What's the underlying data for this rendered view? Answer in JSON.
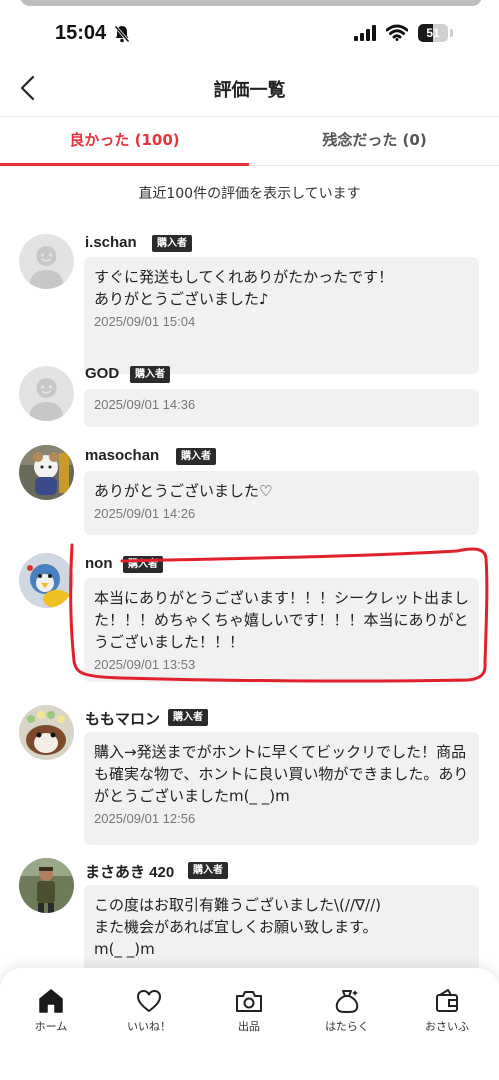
{
  "status_bar": {
    "time": "15:04",
    "battery": "51",
    "battery_level": 0.51
  },
  "header": {
    "title": "評価一覧"
  },
  "tabs": [
    {
      "label": "良かった (100)",
      "active": true
    },
    {
      "label": "残念だった (0)",
      "active": false
    }
  ],
  "info_text": "直近100件の評価を表示しています",
  "badge_label": "購入者",
  "reviews": [
    {
      "name": "i.schan",
      "text": "すぐに発送もしてくれありがたかったです！\nありがとうございました♪",
      "date": "2025/09/01 15:04"
    },
    {
      "name": "GOD",
      "text": "",
      "date": "2025/09/01 14:36"
    },
    {
      "name": "masochan",
      "text": "ありがとうございました♡",
      "date": "2025/09/01 14:26"
    },
    {
      "name": "non",
      "text": "本当にありがとうございます！！！シークレット出ました！！！めちゃくちゃ嬉しいです！！！本当にありがとうございました！！！",
      "date": "2025/09/01 13:53"
    },
    {
      "name": "ももマロン",
      "text": "購入→発送までがホントに早くてビックリでした！商品も確実な物で、ホントに良い買い物ができました。ありがとうございましたm(_ _)m",
      "date": "2025/09/01 12:56"
    },
    {
      "name": "まさあき 420",
      "text": "この度はお取引有難うございました\\(//∇//)\nまた機会があれば宜しくお願い致します。\nm(_ _)m",
      "date": ""
    }
  ],
  "bottom_nav": [
    {
      "label": "ホーム",
      "icon": "home-icon"
    },
    {
      "label": "いいね！",
      "icon": "heart-icon"
    },
    {
      "label": "出品",
      "icon": "camera-icon"
    },
    {
      "label": "はたらく",
      "icon": "money-bag-icon"
    },
    {
      "label": "おさいふ",
      "icon": "wallet-icon"
    }
  ],
  "colors": {
    "accent": "#e8323a",
    "badge": "#2b2b2b",
    "bubble": "#f1f1f1",
    "highlight": "#e0202a"
  }
}
